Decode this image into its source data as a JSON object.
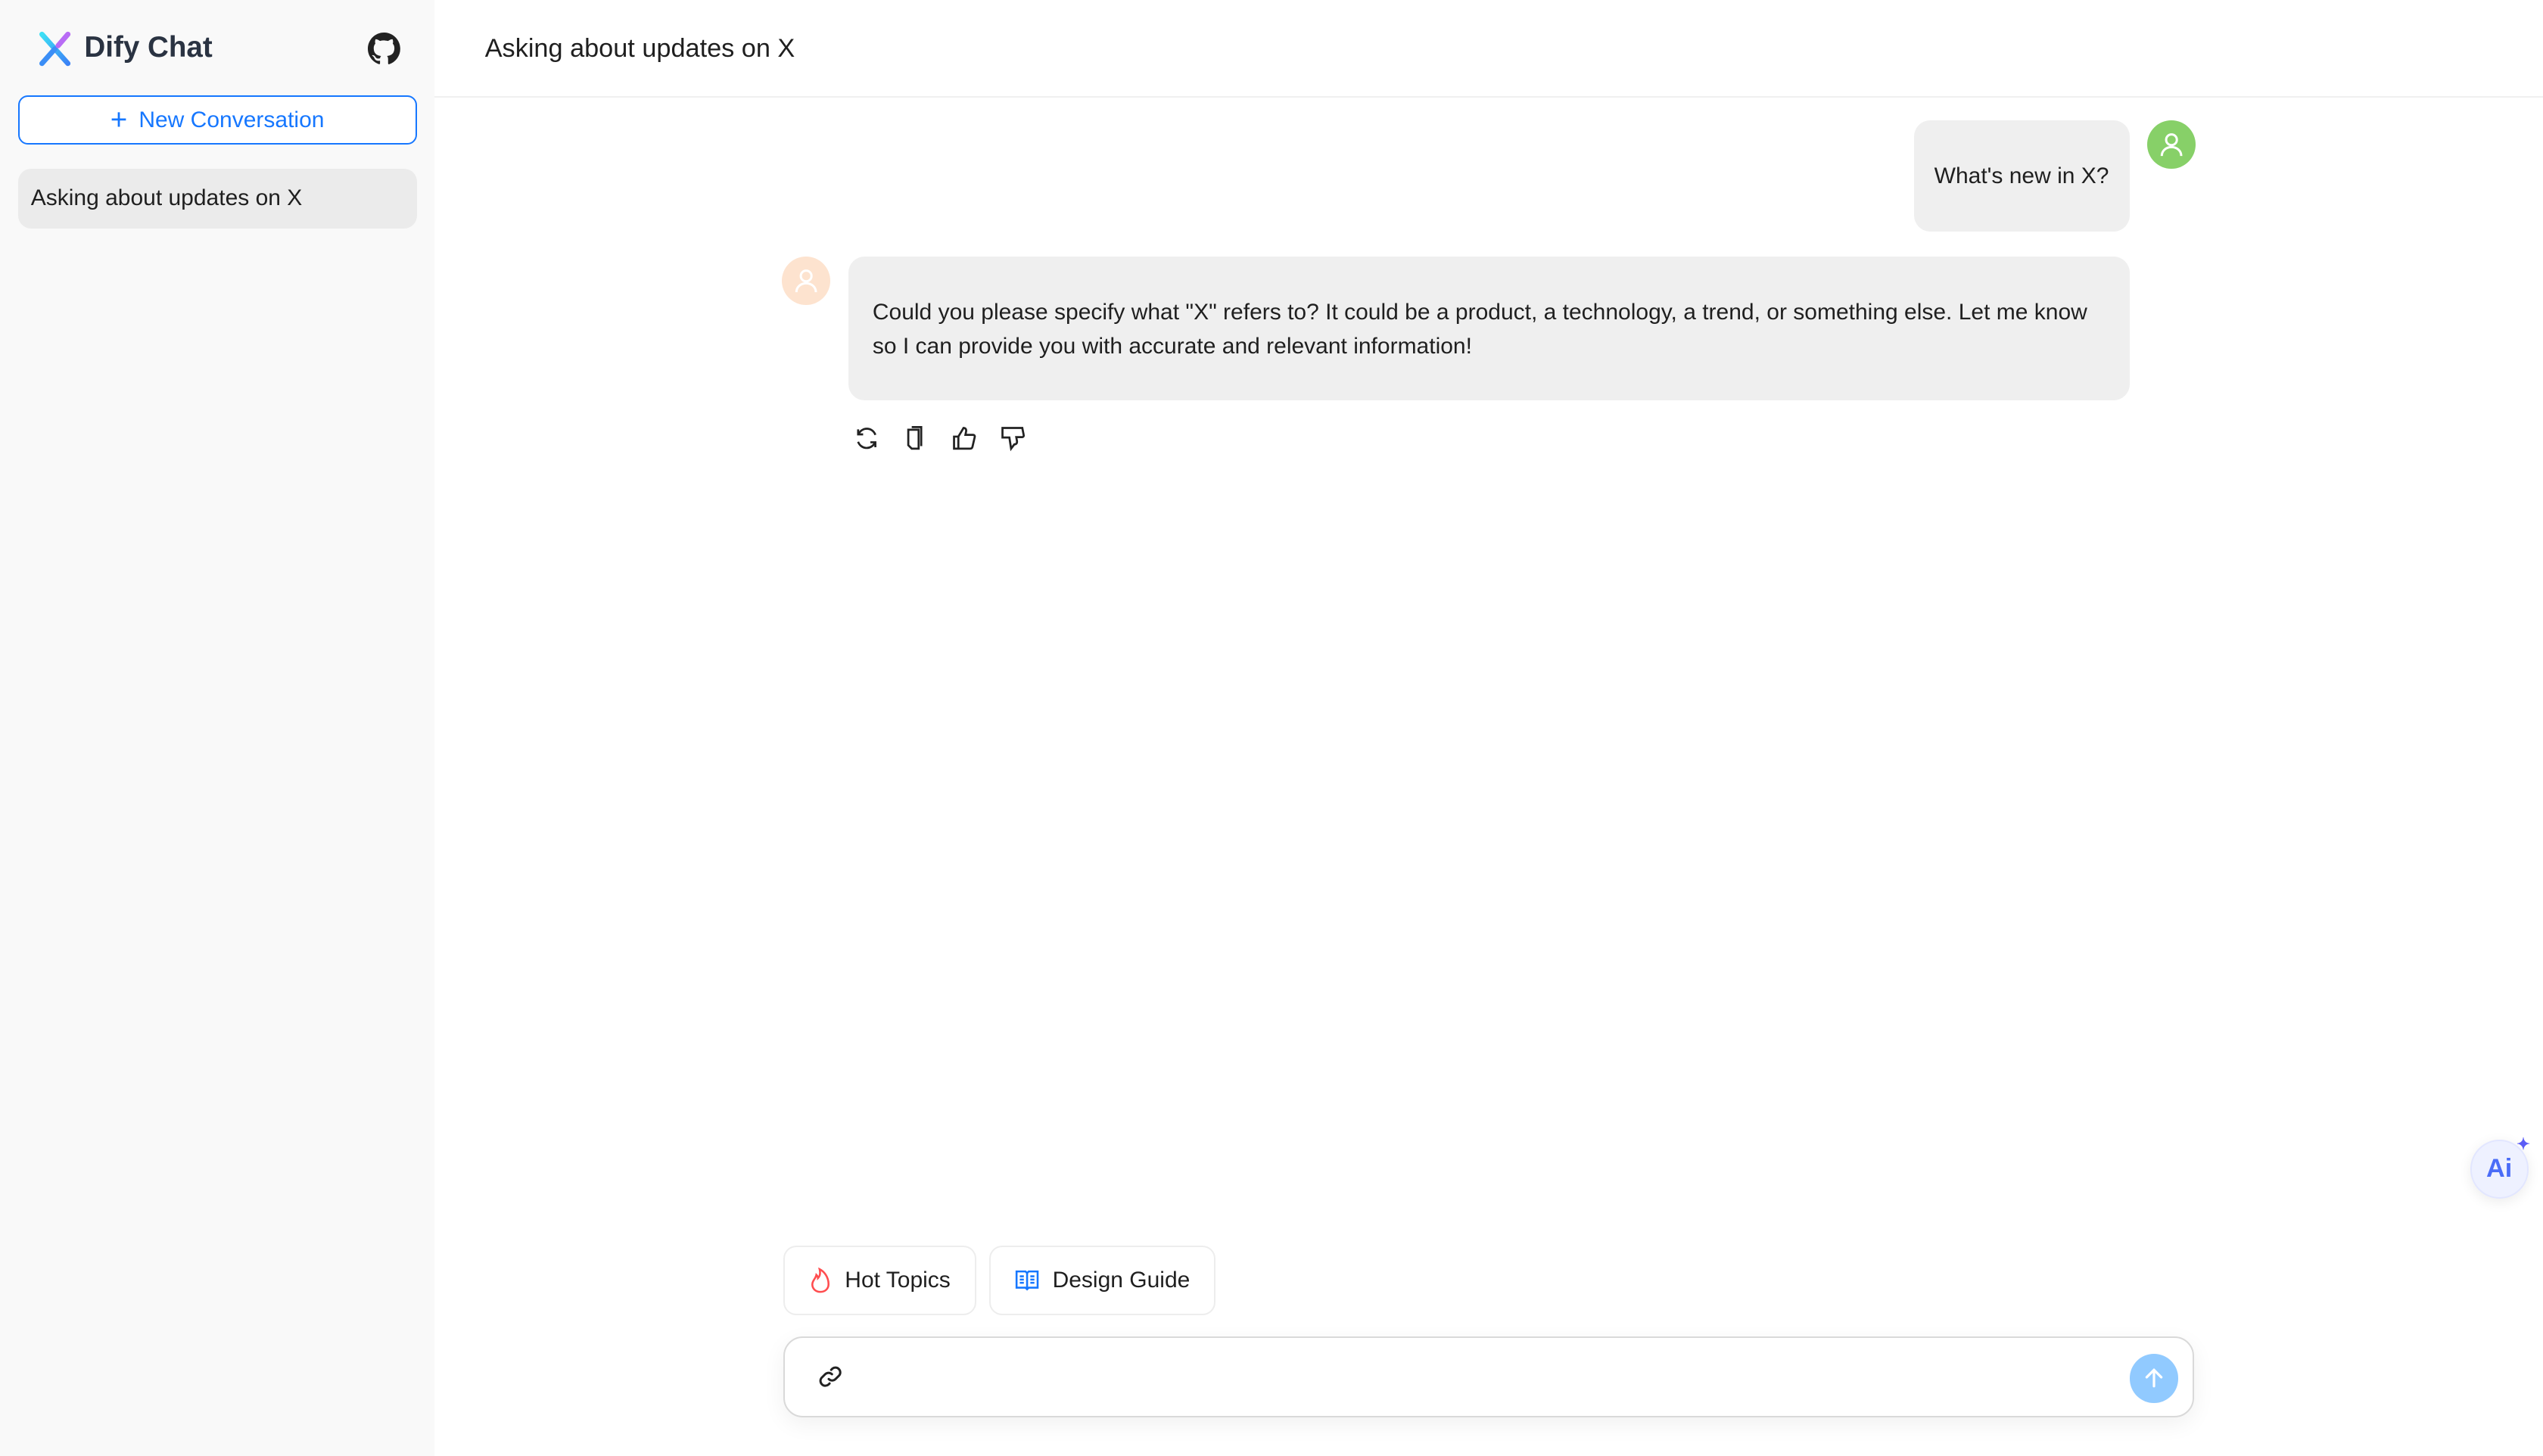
{
  "sidebar": {
    "brand": "Dify Chat",
    "new_conversation_label": "New Conversation",
    "conversations": [
      {
        "label": "Asking about updates on X"
      }
    ]
  },
  "header": {
    "title": "Asking about updates on X"
  },
  "messages": [
    {
      "role": "user",
      "text": "What's new in X?"
    },
    {
      "role": "assistant",
      "text": "Could you please specify what \"X\" refers to? It could be a product, a technology, a trend, or something else. Let me know so I can provide you with accurate and relevant information!"
    }
  ],
  "message_actions": [
    "refresh-icon",
    "copy-icon",
    "thumbs-up-icon",
    "thumbs-down-icon"
  ],
  "prompts": [
    {
      "label": "Hot Topics",
      "icon": "fire-icon"
    },
    {
      "label": "Design Guide",
      "icon": "book-icon"
    }
  ],
  "input": {
    "placeholder": ""
  },
  "ai_fab": {
    "label": "Ai"
  },
  "colors": {
    "primary": "#1677ff",
    "user_avatar": "#87d068",
    "assistant_avatar": "#fde3cf",
    "send": "#91caff"
  }
}
